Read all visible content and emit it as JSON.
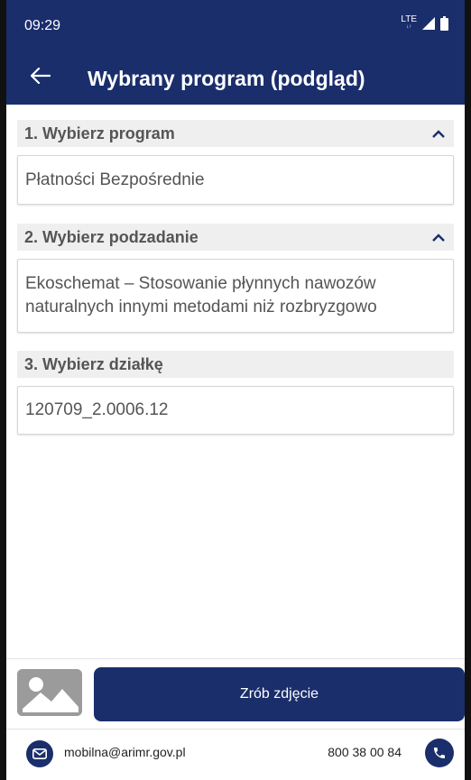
{
  "status_bar": {
    "time": "09:29",
    "network": "LTE"
  },
  "app_bar": {
    "title": "Wybrany program (podgląd)"
  },
  "sections": [
    {
      "title": "1. Wybierz program",
      "value": "Płatności Bezpośrednie"
    },
    {
      "title": "2. Wybierz podzadanie",
      "value_line1": "Ekoschemat – Stosowanie płynnych nawozów",
      "value_line2": "naturalnych innymi metodami niż rozbryzgowo"
    },
    {
      "title": "3. Wybierz działkę",
      "value": "120709_2.0006.12"
    }
  ],
  "actions": {
    "photo_button": "Zrób zdjęcie"
  },
  "footer": {
    "email": "mobilna@arimr.gov.pl",
    "phone": "800 38 00 84"
  },
  "colors": {
    "primary": "#1a2e6b",
    "section_bg": "#efefef",
    "text_gray": "#555555"
  }
}
